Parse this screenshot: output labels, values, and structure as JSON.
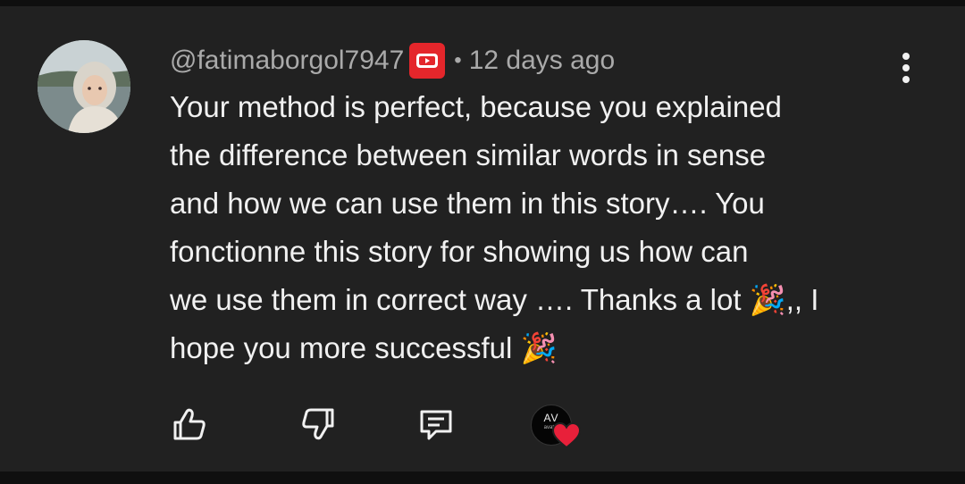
{
  "comment": {
    "handle": "@fatimaborgol7947",
    "timestamp": "12 days ago",
    "separator": "•",
    "text": "Your method is perfect, because you explained\nthe difference between similar words in sense\nand how we can use them in this story…. You\nfonctionne this story for showing us how can\nwe use them in correct way …. Thanks a lot 🎉,, I\nhope you more successful 🎉",
    "member_badge_color": "#e4262b"
  },
  "creator_heart": {
    "avatar_initials": "AV",
    "avatar_subtext": "avatar",
    "heart_color": "#e8203a"
  },
  "actions": [
    {
      "name": "like",
      "icon": "thumb-up-icon"
    },
    {
      "name": "dislike",
      "icon": "thumb-down-icon"
    },
    {
      "name": "reply",
      "icon": "comment-icon"
    }
  ],
  "menu_icon": "more-vertical-icon"
}
